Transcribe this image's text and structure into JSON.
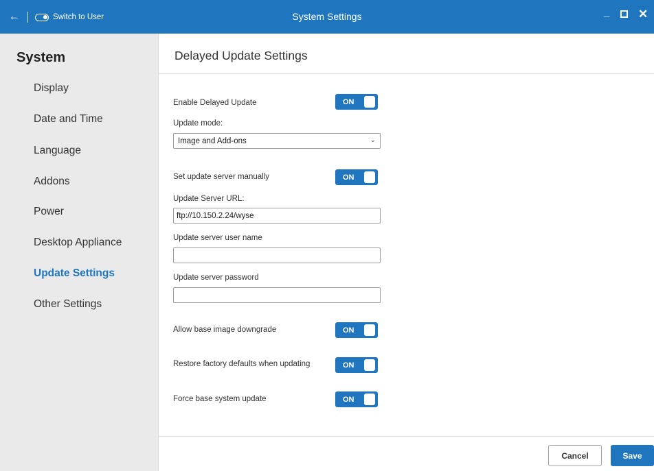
{
  "titlebar": {
    "back_icon": "arrow-left-icon",
    "switch_label": "Switch to User",
    "title": "System Settings",
    "window_controls": [
      "minimize-icon",
      "maximize-icon",
      "close-icon"
    ]
  },
  "sidebar": {
    "heading": "System",
    "items": [
      {
        "label": "Display",
        "active": false
      },
      {
        "label": "Date and Time",
        "active": false
      },
      {
        "label": "Language",
        "active": false
      },
      {
        "label": "Addons",
        "active": false
      },
      {
        "label": "Power",
        "active": false
      },
      {
        "label": "Desktop Appliance",
        "active": false
      },
      {
        "label": "Update Settings",
        "active": true
      },
      {
        "label": "Other Settings",
        "active": false
      }
    ]
  },
  "main": {
    "title": "Delayed Update Settings",
    "enable_delayed_update": {
      "label": "Enable Delayed Update",
      "state": "ON"
    },
    "update_mode": {
      "label": "Update mode:",
      "value": "Image and Add-ons"
    },
    "set_server_manually": {
      "label": "Set update server manually",
      "state": "ON"
    },
    "server_url": {
      "label": "Update Server URL:",
      "value": "ftp://10.150.2.24/wyse"
    },
    "server_user": {
      "label": "Update server user name",
      "value": ""
    },
    "server_password": {
      "label": "Update server password",
      "value": ""
    },
    "allow_downgrade": {
      "label": "Allow base image downgrade",
      "state": "ON"
    },
    "restore_defaults": {
      "label": "Restore factory defaults when updating",
      "state": "ON"
    },
    "force_update": {
      "label": "Force base system update",
      "state": "ON"
    }
  },
  "footer": {
    "cancel_label": "Cancel",
    "save_label": "Save"
  },
  "colors": {
    "accent": "#1f76be",
    "sidebar_bg": "#eaeaea"
  }
}
